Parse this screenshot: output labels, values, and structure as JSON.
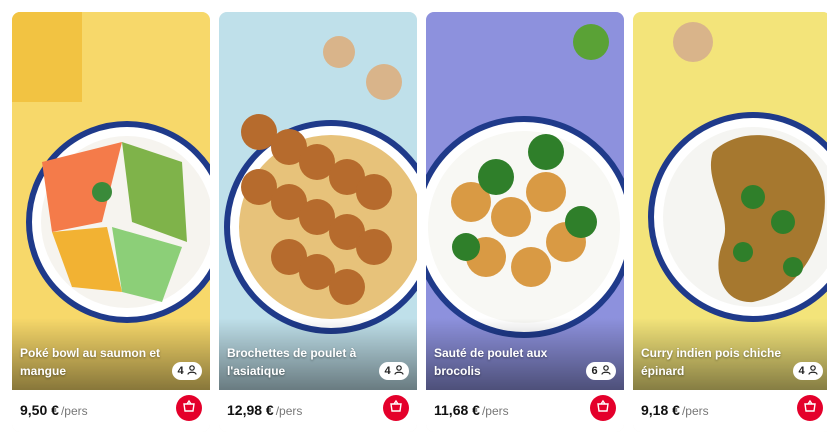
{
  "cards": [
    {
      "title": "Poké bowl au saumon et mangue",
      "portions": "4",
      "price": "9,50 €",
      "unit": "/pers",
      "bg": "#f7d86a"
    },
    {
      "title": "Brochettes de poulet à l'asiatique",
      "portions": "4",
      "price": "12,98 €",
      "unit": "/pers",
      "bg": "#bfe0ea"
    },
    {
      "title": "Sauté de poulet aux brocolis",
      "portions": "6",
      "price": "11,68 €",
      "unit": "/pers",
      "bg": "#8d91dd"
    },
    {
      "title": "Curry indien pois chiche épinard",
      "portions": "4",
      "price": "9,18 €",
      "unit": "/pers",
      "bg": "#f3e47a"
    }
  ],
  "icons": {
    "portion": "person-icon",
    "cart": "basket-icon"
  },
  "colors": {
    "accent": "#e4002b"
  }
}
